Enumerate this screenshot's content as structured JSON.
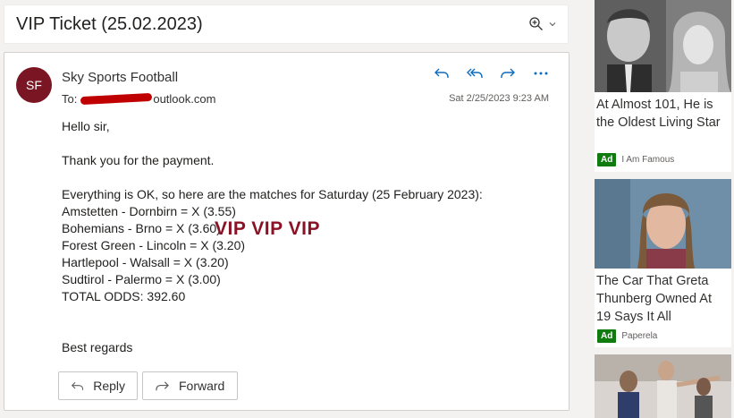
{
  "subject": {
    "title": "VIP Ticket (25.02.2023)"
  },
  "message": {
    "avatar_initials": "SF",
    "sender": "Sky Sports Football",
    "to_label": "To:",
    "to_address_suffix": "outlook.com",
    "date": "Sat 2/25/2023 9:23 AM",
    "body": {
      "greeting": "Hello sir,",
      "thanks": "Thank you for the payment.",
      "intro": "Everything is OK, so here are the matches for Saturday (25 February 2023):",
      "matches": [
        "Amstetten - Dornbirn = X (3.55)",
        "Bohemians - Brno = X (3.60)",
        "Forest Green - Lincoln = X (3.20)",
        "Hartlepool - Walsall = X (3.20)",
        "Sudtirol - Palermo = X (3.00)"
      ],
      "total": "TOTAL ODDS: 392.60",
      "closing": "Best regards"
    },
    "watermark": "VIP VIP VIP",
    "actions": {
      "reply_label": "Reply",
      "forward_label": "Forward"
    }
  },
  "ads": [
    {
      "title": "At Almost 101, He is the Oldest Living Star",
      "badge": "Ad",
      "source": "I Am Famous"
    },
    {
      "title": "The Car That Greta Thunberg Owned At 19 Says It All",
      "badge": "Ad",
      "source": "Paperela"
    },
    {
      "title": ""
    }
  ],
  "colors": {
    "avatar": "#7a1524",
    "watermark": "#8b1226",
    "accent": "#0f6cbd",
    "ad_badge": "#107c10"
  }
}
